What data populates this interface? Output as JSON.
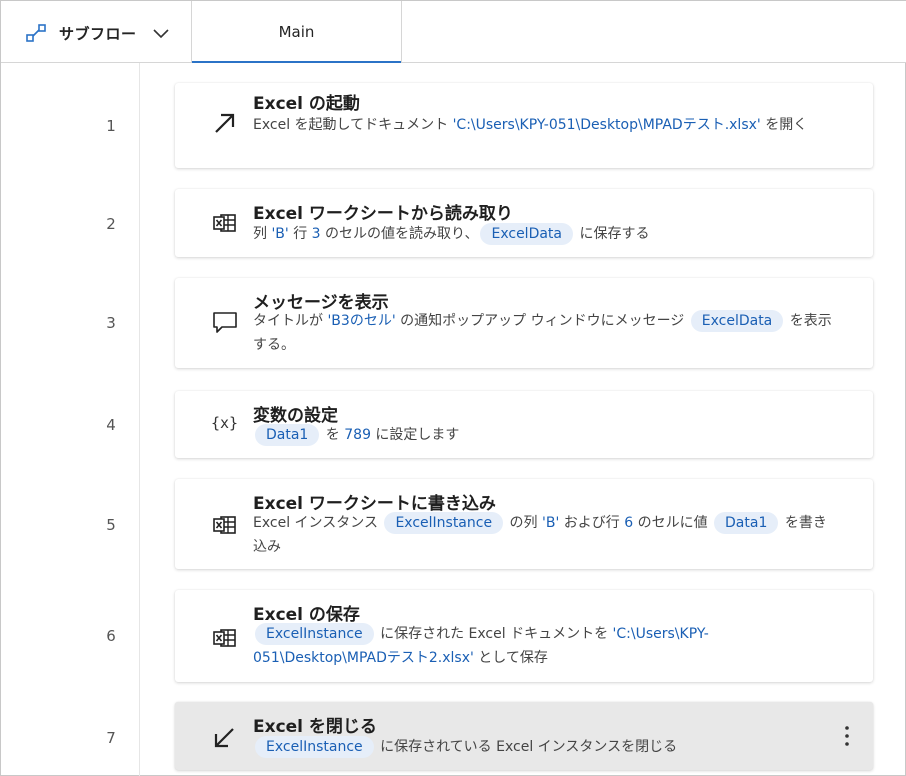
{
  "header": {
    "subflow_label": "サブフロー",
    "tab_main": "Main"
  },
  "steps": [
    {
      "num": "1",
      "icon": "arrow-up-right-icon",
      "title": "Excel の起動",
      "desc": [
        {
          "t": "Excel を起動してドキュメント "
        },
        {
          "h": "'C:\\Users\\KPY-051\\Desktop\\MPADテスト.xlsx'"
        },
        {
          "t": " を開く"
        }
      ]
    },
    {
      "num": "2",
      "icon": "excel-table-icon",
      "title": "Excel ワークシートから読み取り",
      "desc": [
        {
          "t": "列 "
        },
        {
          "h": "'B'"
        },
        {
          "t": " 行 "
        },
        {
          "h": "3"
        },
        {
          "t": " のセルの値を読み取り、"
        },
        {
          "p": "ExcelData"
        },
        {
          "t": " に保存する"
        }
      ]
    },
    {
      "num": "3",
      "icon": "message-icon",
      "title": "メッセージを表示",
      "desc": [
        {
          "t": "タイトルが "
        },
        {
          "h": "'B3のセル'"
        },
        {
          "t": " の通知ポップアップ ウィンドウにメッセージ "
        },
        {
          "p": "ExcelData"
        },
        {
          "t": " を表示する。"
        }
      ]
    },
    {
      "num": "4",
      "icon": "variable-icon",
      "icon_text": "{x}",
      "title": "変数の設定",
      "desc": [
        {
          "p": "Data1"
        },
        {
          "t": " を "
        },
        {
          "h": "789"
        },
        {
          "t": " に設定します"
        }
      ]
    },
    {
      "num": "5",
      "icon": "excel-table-icon",
      "title": "Excel ワークシートに書き込み",
      "desc": [
        {
          "t": "Excel インスタンス "
        },
        {
          "p": "ExcelInstance"
        },
        {
          "t": " の列 "
        },
        {
          "h": "'B'"
        },
        {
          "t": " および行 "
        },
        {
          "h": "6"
        },
        {
          "t": " のセルに値 "
        },
        {
          "p": "Data1"
        },
        {
          "t": " を書き込み"
        }
      ]
    },
    {
      "num": "6",
      "icon": "excel-table-icon",
      "title": "Excel の保存",
      "desc": [
        {
          "p": "ExcelInstance"
        },
        {
          "t": " に保存された Excel ドキュメントを "
        },
        {
          "h": "'C:\\Users\\KPY-051\\Desktop\\MPADテスト2.xlsx'"
        },
        {
          "t": " として保存"
        }
      ]
    },
    {
      "num": "7",
      "icon": "arrow-down-left-icon",
      "title": "Excel を閉じる",
      "desc": [
        {
          "p": "ExcelInstance"
        },
        {
          "t": " に保存されている Excel インスタンスを閉じる"
        }
      ]
    }
  ]
}
